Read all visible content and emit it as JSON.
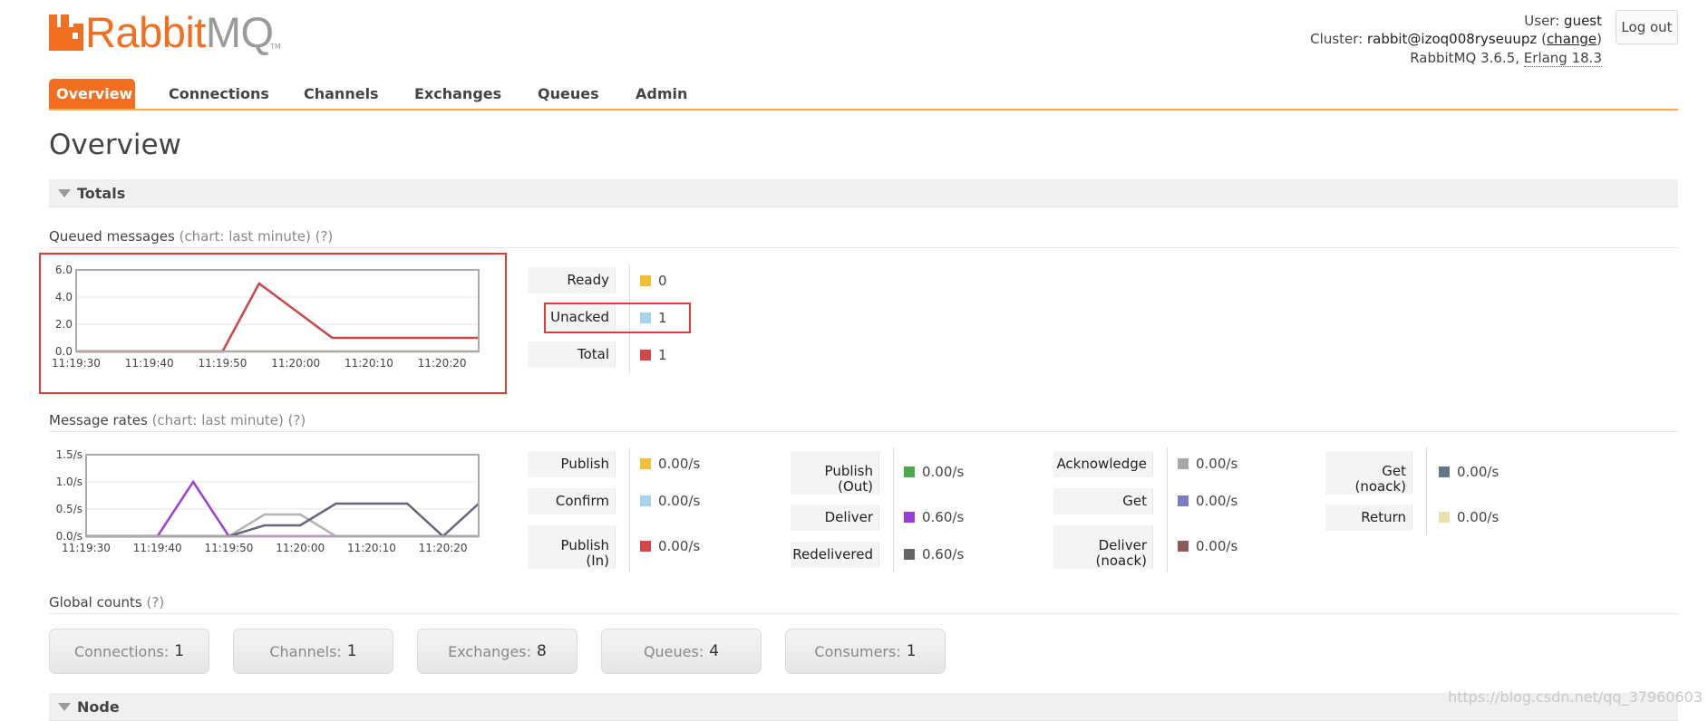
{
  "brand": {
    "name_part1": "Rabbit",
    "name_part2": "MQ",
    "tm": "TM",
    "orange": "#f26f21",
    "grey": "#9a9a9a"
  },
  "header": {
    "user_label": "User:",
    "user": "guest",
    "cluster_label": "Cluster:",
    "cluster": "rabbit@izoq008ryseuupz",
    "cluster_change": "change",
    "version_prefix": "RabbitMQ 3.6.5,",
    "erlang": "Erlang 18.3",
    "logout": "Log out"
  },
  "nav": {
    "tabs": [
      {
        "label": "Overview",
        "active": true
      },
      {
        "label": "Connections"
      },
      {
        "label": "Channels"
      },
      {
        "label": "Exchanges"
      },
      {
        "label": "Queues"
      },
      {
        "label": "Admin"
      }
    ]
  },
  "page_title": "Overview",
  "sections": {
    "totals": "Totals",
    "node": "Node"
  },
  "queued": {
    "title": "Queued messages",
    "chart_note": "(chart: last minute)",
    "help": "(?)",
    "legend": [
      {
        "label": "Ready",
        "value": "0",
        "color": "#f0c03c"
      },
      {
        "label": "Unacked",
        "value": "1",
        "color": "#a8d4f2"
      },
      {
        "label": "Total",
        "value": "1",
        "color": "#d04848"
      }
    ]
  },
  "rates": {
    "title": "Message rates",
    "chart_note": "(chart: last minute)",
    "help": "(?)",
    "columns": [
      [
        {
          "label": "Publish",
          "value": "0.00/s",
          "color": "#f0c03c"
        },
        {
          "label": "Confirm",
          "value": "0.00/s",
          "color": "#a8d4f2"
        },
        {
          "label_l1": "Publish",
          "label_l2": "(In)",
          "value": "0.00/s",
          "color": "#d04848"
        }
      ],
      [
        {
          "label_l1": "Publish",
          "label_l2": "(Out)",
          "value": "0.00/s",
          "color": "#4caa4c"
        },
        {
          "label": "Deliver",
          "value": "0.60/s",
          "color": "#9b3bdc"
        },
        {
          "label": "Redelivered",
          "value": "0.60/s",
          "color": "#666666"
        }
      ],
      [
        {
          "label": "Acknowledge",
          "value": "0.00/s",
          "color": "#a8a8a8"
        },
        {
          "label": "Get",
          "value": "0.00/s",
          "color": "#7b7bc8"
        },
        {
          "label_l1": "Deliver",
          "label_l2": "(noack)",
          "value": "0.00/s",
          "color": "#8f5a5a"
        }
      ],
      [
        {
          "label_l1": "Get",
          "label_l2": "(noack)",
          "value": "0.00/s",
          "color": "#627685"
        },
        {
          "label": "Return",
          "value": "0.00/s",
          "color": "#e6e2a8"
        }
      ]
    ]
  },
  "global": {
    "title": "Global counts",
    "help": "(?)",
    "items": [
      {
        "label": "Connections:",
        "value": "1"
      },
      {
        "label": "Channels:",
        "value": "1"
      },
      {
        "label": "Exchanges:",
        "value": "8"
      },
      {
        "label": "Queues:",
        "value": "4"
      },
      {
        "label": "Consumers:",
        "value": "1"
      }
    ]
  },
  "watermark": "https://blog.csdn.net/qq_37960603",
  "chart_data": [
    {
      "type": "line",
      "title": "",
      "x": [
        "11:19:30",
        "11:19:35",
        "11:19:40",
        "11:19:45",
        "11:19:50",
        "11:19:55",
        "11:20:00",
        "11:20:05",
        "11:20:10",
        "11:20:15",
        "11:20:20",
        "11:20:25"
      ],
      "x_ticks": [
        "11:19:30",
        "11:19:40",
        "11:19:50",
        "11:20:00",
        "11:20:10",
        "11:20:20"
      ],
      "y_ticks": [
        "0.0",
        "2.0",
        "4.0",
        "6.0"
      ],
      "ylim": [
        0,
        6
      ],
      "series": [
        {
          "name": "Ready",
          "color": "#f0c03c",
          "values": [
            0,
            0,
            0,
            0,
            0,
            0,
            0,
            0,
            0,
            0,
            0,
            0
          ]
        },
        {
          "name": "Unacked",
          "color": "#a8d4f2",
          "values": [
            0,
            0,
            0,
            0,
            0,
            0,
            0,
            0,
            0,
            0,
            0,
            0
          ]
        },
        {
          "name": "Total",
          "color": "#c8474c",
          "values": [
            0,
            0,
            0,
            0,
            0,
            5,
            3,
            1,
            1,
            1,
            1,
            1
          ]
        }
      ]
    },
    {
      "type": "line",
      "title": "",
      "x": [
        "11:19:30",
        "11:19:35",
        "11:19:40",
        "11:19:45",
        "11:19:50",
        "11:19:55",
        "11:20:00",
        "11:20:05",
        "11:20:10",
        "11:20:15",
        "11:20:20",
        "11:20:25"
      ],
      "x_ticks": [
        "11:19:30",
        "11:19:40",
        "11:19:50",
        "11:20:00",
        "11:20:10",
        "11:20:20"
      ],
      "y_ticks": [
        "0.0/s",
        "0.5/s",
        "1.0/s",
        "1.5/s"
      ],
      "ylim": [
        0,
        1.5
      ],
      "series": [
        {
          "name": "Publish",
          "color": "#e6e2a8",
          "values": [
            0,
            0,
            0,
            0,
            0,
            0,
            0,
            0,
            0,
            0,
            0,
            0
          ]
        },
        {
          "name": "Deliver",
          "color": "#9b3bdc",
          "values": [
            0,
            0,
            0,
            1.0,
            0,
            0,
            0,
            0,
            0,
            0,
            0,
            0
          ]
        },
        {
          "name": "Acknowledge",
          "color": "#b4b4b4",
          "values": [
            0,
            0,
            0,
            0,
            0,
            0.4,
            0.4,
            0,
            0,
            0,
            0,
            0
          ]
        },
        {
          "name": "Redelivered",
          "color": "#66667a",
          "values": [
            0,
            0,
            0,
            0,
            0,
            0.2,
            0.2,
            0.6,
            0.6,
            0.6,
            0,
            0.6
          ]
        }
      ]
    }
  ]
}
